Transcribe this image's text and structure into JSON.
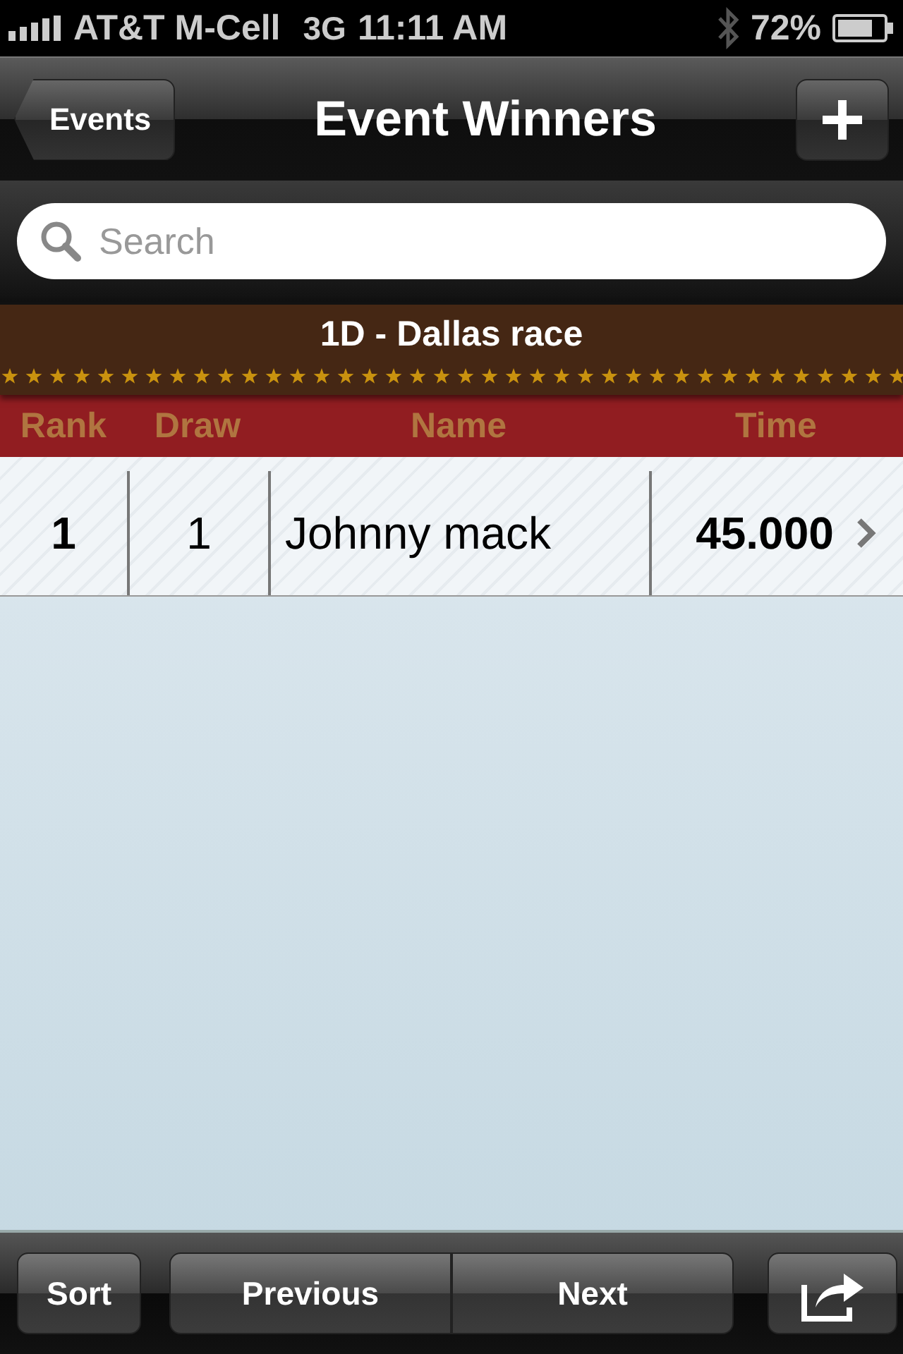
{
  "status_bar": {
    "carrier": "AT&T M-Cell",
    "network": "3G",
    "time": "11:11 AM",
    "battery": "72%"
  },
  "nav_bar": {
    "back_button": "Events",
    "title": "Event Winners"
  },
  "search": {
    "placeholder": "Search"
  },
  "section": {
    "title": "1D - Dallas race"
  },
  "table": {
    "columns": [
      "Rank",
      "Draw",
      "Name",
      "Time"
    ],
    "rows": [
      {
        "cells": [
          "1",
          "1",
          "Johnny mack",
          "45.000"
        ]
      }
    ]
  },
  "toolbar": {
    "sort": "Sort",
    "previous": "Previous",
    "next": "Next"
  }
}
